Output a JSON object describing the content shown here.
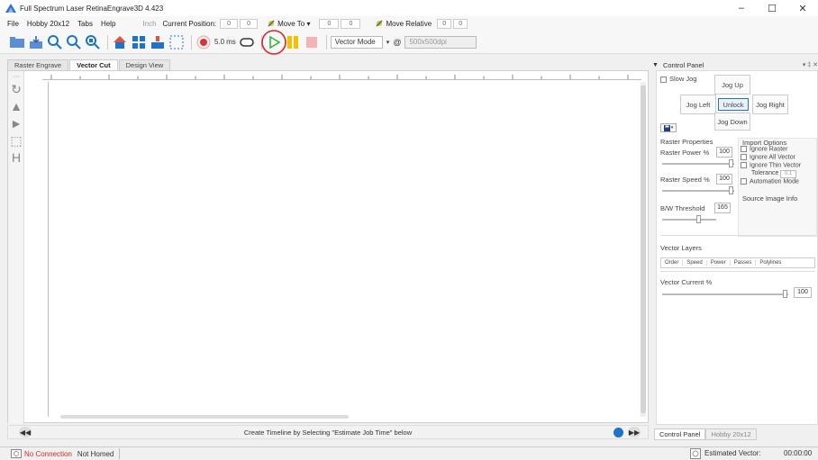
{
  "window": {
    "title": "Full Spectrum Laser RetinaEngrave3D 4.423",
    "controls": [
      "–",
      "☐",
      "✕"
    ]
  },
  "menu": {
    "file": "File",
    "machine": "Hobby 20x12",
    "tabs": "Tabs",
    "help": "Help",
    "units": "Inch",
    "current_position_label": "Current Position:",
    "current_position_x": "0",
    "current_position_y": "0",
    "move_to_label": "Move To",
    "move_to_x": "0",
    "move_to_y": "0",
    "move_relative_label": "Move Relative",
    "move_relative_x": "0",
    "move_relative_y": "0"
  },
  "toolbar": {
    "pulse_value": "5.0",
    "pulse_unit": "ms",
    "mode_select": "Vector Mode",
    "dpi_value": "500x500dpi",
    "at_symbol": "@"
  },
  "tabs": [
    "Raster Engrave",
    "Vector Cut",
    "Design View"
  ],
  "timeline": {
    "message": "Create Timeline by Selecting \"Estimate Job Time\" below"
  },
  "control_panel": {
    "title": "Control Panel",
    "header_controls": "▾ ‡ ✕",
    "slow_jog": "Slow Jog",
    "jog_up": "Jog Up",
    "jog_left": "Jog Left",
    "unlock": "Unlock",
    "jog_right": "Jog Right",
    "jog_down": "Jog Down",
    "raster_properties": "Raster Properties",
    "raster_power_label": "Raster Power %",
    "raster_power_value": "100",
    "raster_speed_label": "Raster Speed %",
    "raster_speed_value": "100",
    "bw_threshold_label": "B/W Threshold",
    "bw_threshold_value": "165",
    "import_options": "Import Options",
    "ignore_raster": "Ignore Raster",
    "ignore_all_vector": "Ignore All Vector",
    "ignore_thin_vector": "Ignore Thin Vector",
    "tolerance_label": "Tolerance",
    "tolerance_value": "0.1",
    "automation_mode": "Automation Mode",
    "source_image_info": "Source Image Info",
    "vector_layers": "Vector Layers",
    "layer_columns": [
      "Order",
      "Speed",
      "Power",
      "Passes",
      "Polylines"
    ],
    "vector_current_label": "Vector Current %",
    "vector_current_value": "100"
  },
  "bottom_tabs": [
    "Control Panel",
    "Hobby 20x12"
  ],
  "status": {
    "connection": "No Connection",
    "homed": "Not Homed",
    "estimated_label": "Estimated Vector:",
    "estimated_time": "00:00:00"
  },
  "colors": {
    "accent_blue": "#1e73c8",
    "play_green": "#3cb043",
    "pause_yellow": "#f2c200",
    "stop_red": "#f4b4b4",
    "highlight_circle": "#d9262c",
    "no_connection_red": "#d9262c"
  }
}
